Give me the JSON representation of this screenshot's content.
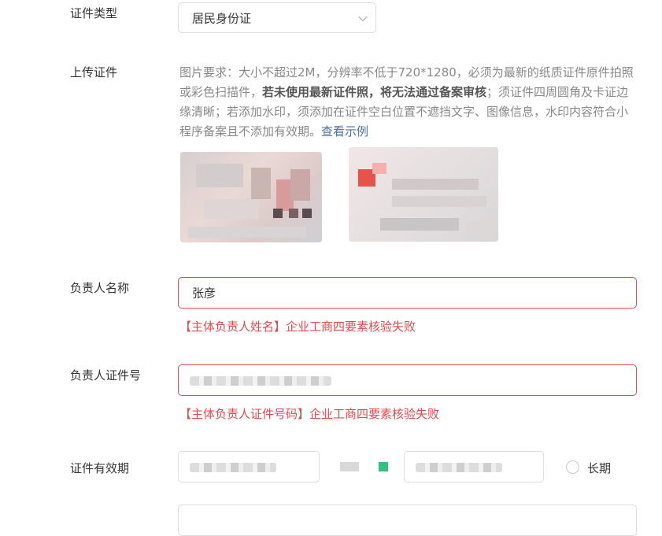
{
  "id_type": {
    "label": "证件类型",
    "value": "居民身份证"
  },
  "upload": {
    "label": "上传证件",
    "req_prefix": "图片要求：大小不超过2M，分辨率不低于720*1280，必须为最新的纸质证件原件拍照或彩色扫描件，",
    "req_bold": "若未使用最新证件照，将无法通过备案审核",
    "req_suffix": "；须证件四周圆角及卡证边缘清晰；若添加水印，须添加在证件空白位置不遮挡文字、图像信息，水印内容符合小程序备案且不添加有效期。",
    "example_link": "查看示例"
  },
  "owner_name": {
    "label": "负责人名称",
    "value": "张彦",
    "error": "【主体负责人姓名】企业工商四要素核验失败"
  },
  "owner_id": {
    "label": "负责人证件号",
    "error": "【主体负责人证件号码】企业工商四要素核验失败"
  },
  "validity": {
    "label": "证件有效期",
    "long_term_label": "长期"
  },
  "colors": {
    "error": "#e5484d",
    "link": "#4a6fa5",
    "highlight": "#2ec27e"
  }
}
